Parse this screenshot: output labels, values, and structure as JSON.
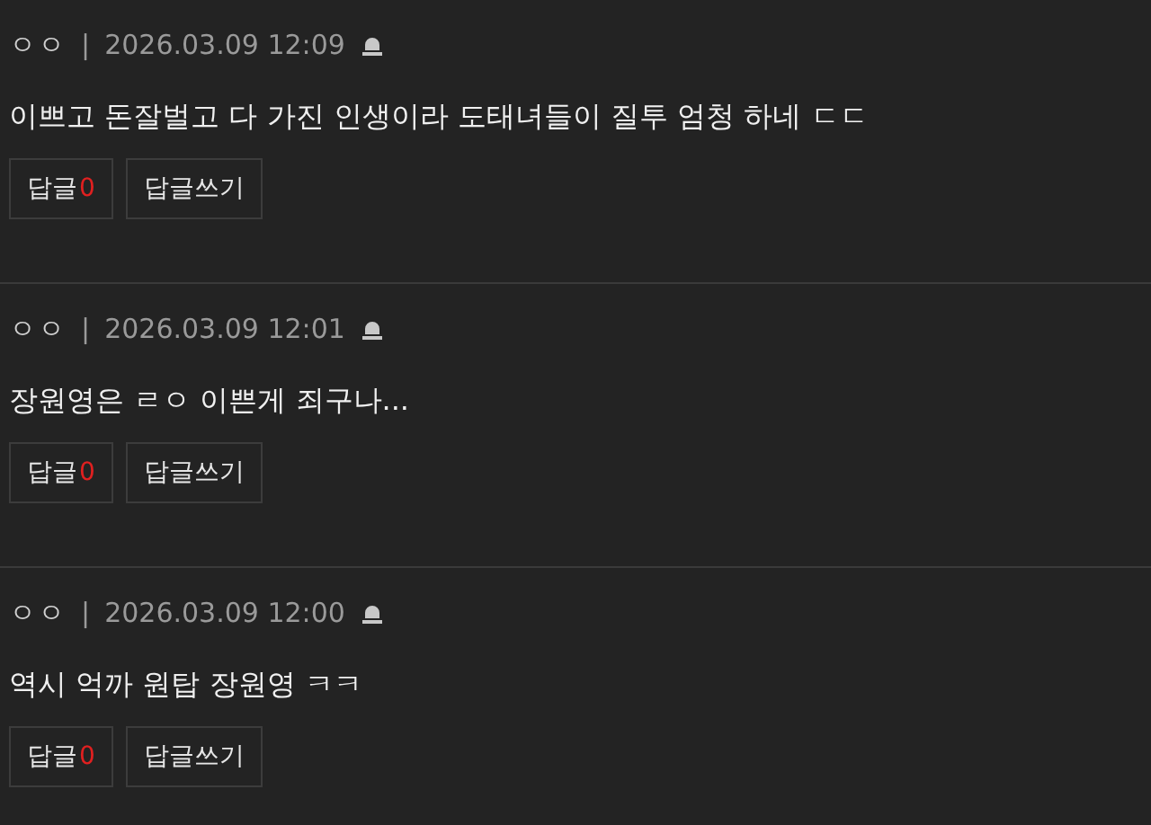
{
  "comments": [
    {
      "author": "ㅇㅇ",
      "separator": "|",
      "date": "2026.03.09 12:09",
      "text": "이쁘고 돈잘벌고 다 가진 인생이라 도태녀들이 질투 엄청 하네 ㄷㄷ",
      "reply_label": "답글",
      "reply_count": "0",
      "write_reply": "답글쓰기"
    },
    {
      "author": "ㅇㅇ",
      "separator": "|",
      "date": "2026.03.09 12:01",
      "text": "장원영은 ㄹㅇ 이쁜게 죄구나...",
      "reply_label": "답글",
      "reply_count": "0",
      "write_reply": "답글쓰기"
    },
    {
      "author": "ㅇㅇ",
      "separator": "|",
      "date": "2026.03.09 12:00",
      "text": "역시 억까 원탑 장원영 ㅋㅋ",
      "reply_label": "답글",
      "reply_count": "0",
      "write_reply": "답글쓰기"
    }
  ]
}
